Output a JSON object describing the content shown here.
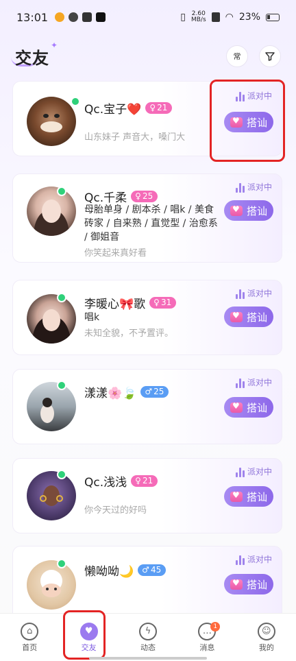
{
  "status_bar": {
    "time": "13:01",
    "net_speed": "2.60",
    "net_unit": "MB/s",
    "battery": "23%"
  },
  "header": {
    "title": "交友",
    "btn_frequent": "常",
    "btn_filter_icon": "filter-icon"
  },
  "party_label": "派对中",
  "chat_label": "搭讪",
  "users": [
    {
      "name": "Qc.宝子❤️",
      "gender": "female",
      "age": "21",
      "tags": "",
      "bio": "山东妹子    声音大，嗓门大"
    },
    {
      "name": "Qc.千柔",
      "gender": "female",
      "age": "25",
      "tags": "母胎单身 / 剧本杀 / 唱k / 美食砖家 / 自来熟 / 直觉型 / 治愈系 / 御姐音",
      "bio": "你笑起来真好看"
    },
    {
      "name": "李暖心🎀歌",
      "gender": "female",
      "age": "31",
      "tags": "唱k",
      "bio": "未知全貌，不予置评。"
    },
    {
      "name": "漾漾🌸🍃",
      "gender": "male",
      "age": "25",
      "tags": "",
      "bio": ""
    },
    {
      "name": "Qc.浅浅",
      "gender": "female",
      "age": "21",
      "tags": "",
      "bio": "你今天过的好吗"
    },
    {
      "name": "懒呦呦🌙",
      "gender": "male",
      "age": "45",
      "tags": "",
      "bio": ""
    }
  ],
  "nav": {
    "home": "首页",
    "friends": "交友",
    "moments": "动态",
    "messages": "消息",
    "messages_badge": "1",
    "me": "我的"
  },
  "colors": {
    "accent": "#8d68ea",
    "online": "#2fd17a",
    "female_badge": "#f56bb8",
    "male_badge": "#5a9df4",
    "highlight": "#e32424"
  }
}
